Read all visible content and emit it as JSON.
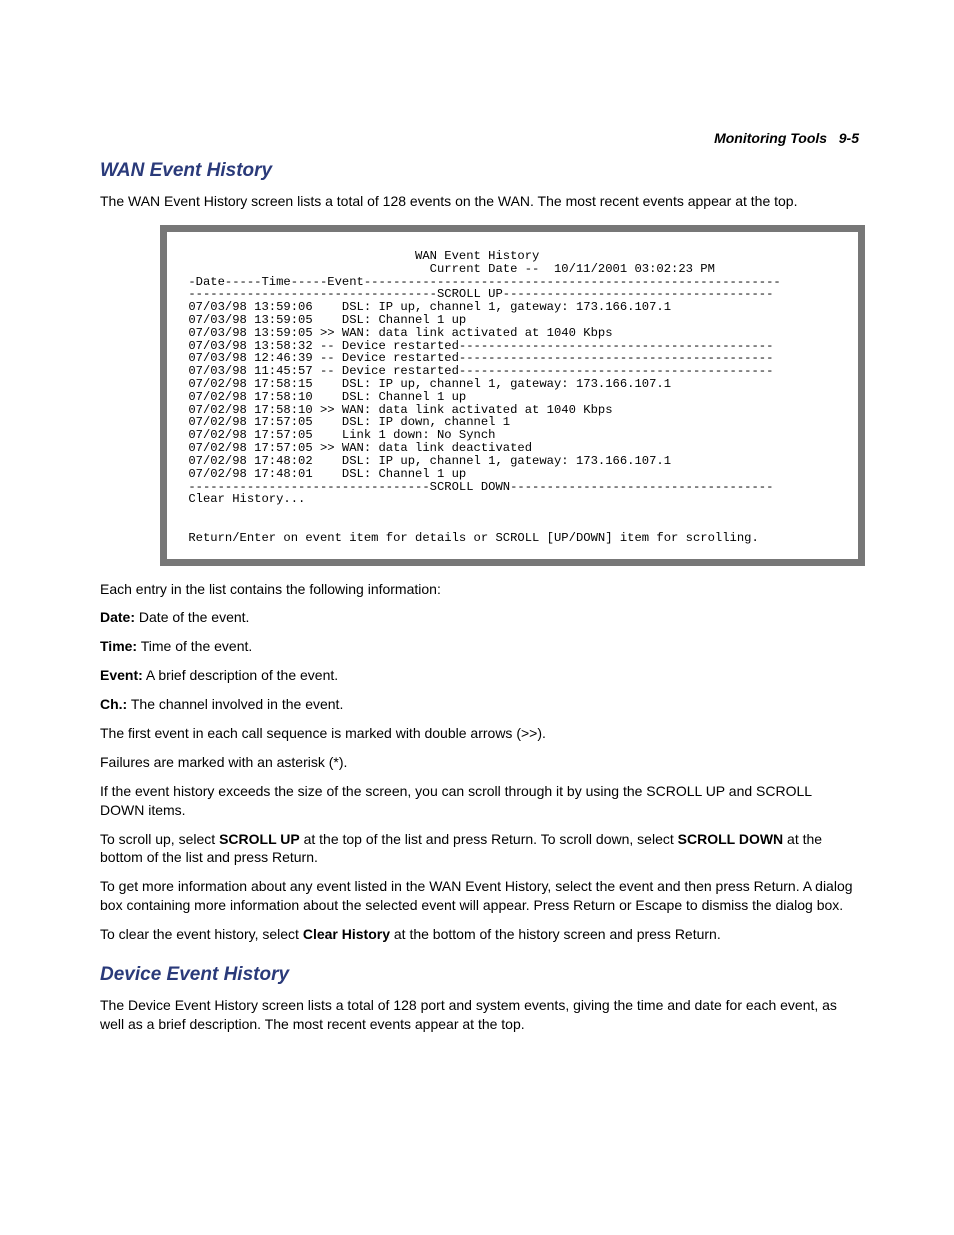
{
  "header": {
    "section": "Monitoring Tools",
    "page": "9-5"
  },
  "wan": {
    "title": "WAN Event History",
    "intro": "The WAN Event History screen lists a total of 128 events on the WAN. The most recent events appear at the top.",
    "terminal": {
      "title": "WAN Event History",
      "current_date_label": "Current Date --",
      "current_date": "10/11/2001 03:02:23 PM",
      "columns_line": " -Date-----Time-----Event---------------------------------------------------------",
      "scroll_up_line": " ----------------------------------SCROLL UP-------------------------------------",
      "events": [
        {
          "date": "07/03/98",
          "time": "13:59:06",
          "mark": "  ",
          "text": "DSL: IP up, channel 1, gateway: 173.166.107.1"
        },
        {
          "date": "07/03/98",
          "time": "13:59:05",
          "mark": "  ",
          "text": "DSL: Channel 1 up"
        },
        {
          "date": "07/03/98",
          "time": "13:59:05",
          "mark": ">>",
          "text": "WAN: data link activated at 1040 Kbps"
        },
        {
          "date": "07/03/98",
          "time": "13:58:32",
          "mark": "--",
          "text": "Device restarted-------------------------------------------"
        },
        {
          "date": "07/03/98",
          "time": "12:46:39",
          "mark": "--",
          "text": "Device restarted-------------------------------------------"
        },
        {
          "date": "07/03/98",
          "time": "11:45:57",
          "mark": "--",
          "text": "Device restarted-------------------------------------------"
        },
        {
          "date": "07/02/98",
          "time": "17:58:15",
          "mark": "  ",
          "text": "DSL: IP up, channel 1, gateway: 173.166.107.1"
        },
        {
          "date": "07/02/98",
          "time": "17:58:10",
          "mark": "  ",
          "text": "DSL: Channel 1 up"
        },
        {
          "date": "07/02/98",
          "time": "17:58:10",
          "mark": ">>",
          "text": "WAN: data link activated at 1040 Kbps"
        },
        {
          "date": "07/02/98",
          "time": "17:57:05",
          "mark": "  ",
          "text": "DSL: IP down, channel 1"
        },
        {
          "date": "07/02/98",
          "time": "17:57:05",
          "mark": "  ",
          "text": "Link 1 down: No Synch"
        },
        {
          "date": "07/02/98",
          "time": "17:57:05",
          "mark": ">>",
          "text": "WAN: data link deactivated"
        },
        {
          "date": "07/02/98",
          "time": "17:48:02",
          "mark": "  ",
          "text": "DSL: IP up, channel 1, gateway: 173.166.107.1"
        },
        {
          "date": "07/02/98",
          "time": "17:48:01",
          "mark": "  ",
          "text": "DSL: Channel 1 up"
        }
      ],
      "scroll_down_line": " ---------------------------------SCROLL DOWN------------------------------------",
      "clear": "Clear History...",
      "footer": "Return/Enter on event item for details or SCROLL [UP/DOWN] item for scrolling."
    },
    "after_intro": "Each entry in the list contains the following information:",
    "defs": {
      "date_l": "Date:",
      "date_t": " Date of the event.",
      "time_l": "Time:",
      "time_t": " Time of the event.",
      "event_l": "Event:",
      "event_t": " A brief description of the event.",
      "ch_l": "Ch.:",
      "ch_t": " The channel involved in the event."
    },
    "p_first": "The first event in each call sequence is marked with double arrows (>>).",
    "p_fail": "Failures are marked with an asterisk (*).",
    "p_scroll": "If the event history exceeds the size of the screen, you can scroll through it by using the SCROLL UP and SCROLL DOWN items.",
    "scroll_instr": {
      "a": "To scroll up, select ",
      "b": "SCROLL UP",
      "c": " at the top of the list and press Return. To scroll down, select ",
      "d": "SCROLL DOWN",
      "e": " at the bottom of the list and press Return."
    },
    "p_moreinfo": "To get more information about any event listed in the WAN Event History, select the event and then press Return. A dialog box containing more information about the selected event will appear. Press Return or Escape to dismiss the dialog box.",
    "clear_instr": {
      "a": "To clear the event history, select ",
      "b": "Clear History",
      "c": " at the bottom of the history screen and press Return."
    }
  },
  "device": {
    "title": "Device Event History",
    "intro": "The Device Event History screen lists a total of 128 port and system events, giving the time and date for each event, as well as a brief description. The most recent events appear at the top."
  }
}
